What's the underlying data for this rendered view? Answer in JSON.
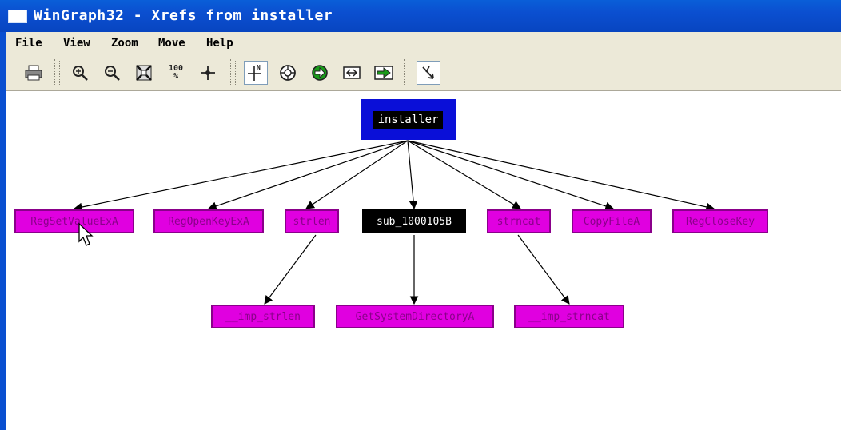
{
  "window": {
    "title": "WinGraph32 - Xrefs from installer"
  },
  "menu": {
    "items": [
      "File",
      "View",
      "Zoom",
      "Move",
      "Help"
    ]
  },
  "toolbar": {
    "buttons": [
      "print-icon",
      "zoom-in-icon",
      "zoom-out-icon",
      "fit-window-icon",
      "zoom-100-icon",
      "center-icon",
      "north-layout-icon",
      "circle-layout-icon",
      "forward-icon",
      "export-icon",
      "next-icon",
      "edge-tool-icon"
    ],
    "zoom_100_label": "100",
    "zoom_100_sub": "%",
    "north_label": "N"
  },
  "graph": {
    "root": "installer",
    "level1": [
      "RegSetValueExA",
      "RegOpenKeyExA",
      "strlen",
      "sub_1000105B",
      "strncat",
      "CopyFileA",
      "RegCloseKey"
    ],
    "level2": [
      "__imp_strlen",
      "GetSystemDirectoryA",
      "__imp_strncat"
    ],
    "colors": {
      "root_border": "#0a0fd8",
      "import_node": "#e000e0",
      "import_text": "#8a008a",
      "local_node": "#000000"
    }
  }
}
